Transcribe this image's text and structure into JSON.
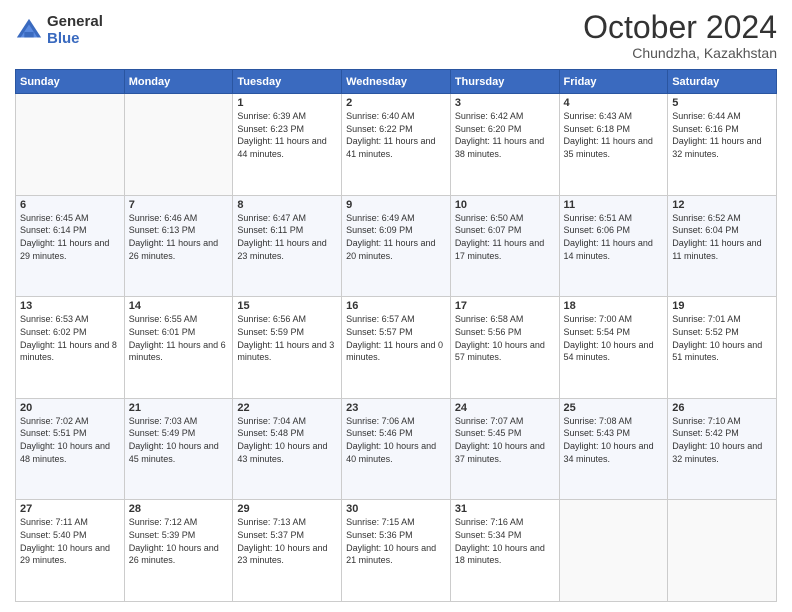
{
  "logo": {
    "general": "General",
    "blue": "Blue"
  },
  "header": {
    "month": "October 2024",
    "location": "Chundzha, Kazakhstan"
  },
  "days_of_week": [
    "Sunday",
    "Monday",
    "Tuesday",
    "Wednesday",
    "Thursday",
    "Friday",
    "Saturday"
  ],
  "weeks": [
    [
      {
        "day": "",
        "sunrise": "",
        "sunset": "",
        "daylight": ""
      },
      {
        "day": "",
        "sunrise": "",
        "sunset": "",
        "daylight": ""
      },
      {
        "day": "1",
        "sunrise": "Sunrise: 6:39 AM",
        "sunset": "Sunset: 6:23 PM",
        "daylight": "Daylight: 11 hours and 44 minutes."
      },
      {
        "day": "2",
        "sunrise": "Sunrise: 6:40 AM",
        "sunset": "Sunset: 6:22 PM",
        "daylight": "Daylight: 11 hours and 41 minutes."
      },
      {
        "day": "3",
        "sunrise": "Sunrise: 6:42 AM",
        "sunset": "Sunset: 6:20 PM",
        "daylight": "Daylight: 11 hours and 38 minutes."
      },
      {
        "day": "4",
        "sunrise": "Sunrise: 6:43 AM",
        "sunset": "Sunset: 6:18 PM",
        "daylight": "Daylight: 11 hours and 35 minutes."
      },
      {
        "day": "5",
        "sunrise": "Sunrise: 6:44 AM",
        "sunset": "Sunset: 6:16 PM",
        "daylight": "Daylight: 11 hours and 32 minutes."
      }
    ],
    [
      {
        "day": "6",
        "sunrise": "Sunrise: 6:45 AM",
        "sunset": "Sunset: 6:14 PM",
        "daylight": "Daylight: 11 hours and 29 minutes."
      },
      {
        "day": "7",
        "sunrise": "Sunrise: 6:46 AM",
        "sunset": "Sunset: 6:13 PM",
        "daylight": "Daylight: 11 hours and 26 minutes."
      },
      {
        "day": "8",
        "sunrise": "Sunrise: 6:47 AM",
        "sunset": "Sunset: 6:11 PM",
        "daylight": "Daylight: 11 hours and 23 minutes."
      },
      {
        "day": "9",
        "sunrise": "Sunrise: 6:49 AM",
        "sunset": "Sunset: 6:09 PM",
        "daylight": "Daylight: 11 hours and 20 minutes."
      },
      {
        "day": "10",
        "sunrise": "Sunrise: 6:50 AM",
        "sunset": "Sunset: 6:07 PM",
        "daylight": "Daylight: 11 hours and 17 minutes."
      },
      {
        "day": "11",
        "sunrise": "Sunrise: 6:51 AM",
        "sunset": "Sunset: 6:06 PM",
        "daylight": "Daylight: 11 hours and 14 minutes."
      },
      {
        "day": "12",
        "sunrise": "Sunrise: 6:52 AM",
        "sunset": "Sunset: 6:04 PM",
        "daylight": "Daylight: 11 hours and 11 minutes."
      }
    ],
    [
      {
        "day": "13",
        "sunrise": "Sunrise: 6:53 AM",
        "sunset": "Sunset: 6:02 PM",
        "daylight": "Daylight: 11 hours and 8 minutes."
      },
      {
        "day": "14",
        "sunrise": "Sunrise: 6:55 AM",
        "sunset": "Sunset: 6:01 PM",
        "daylight": "Daylight: 11 hours and 6 minutes."
      },
      {
        "day": "15",
        "sunrise": "Sunrise: 6:56 AM",
        "sunset": "Sunset: 5:59 PM",
        "daylight": "Daylight: 11 hours and 3 minutes."
      },
      {
        "day": "16",
        "sunrise": "Sunrise: 6:57 AM",
        "sunset": "Sunset: 5:57 PM",
        "daylight": "Daylight: 11 hours and 0 minutes."
      },
      {
        "day": "17",
        "sunrise": "Sunrise: 6:58 AM",
        "sunset": "Sunset: 5:56 PM",
        "daylight": "Daylight: 10 hours and 57 minutes."
      },
      {
        "day": "18",
        "sunrise": "Sunrise: 7:00 AM",
        "sunset": "Sunset: 5:54 PM",
        "daylight": "Daylight: 10 hours and 54 minutes."
      },
      {
        "day": "19",
        "sunrise": "Sunrise: 7:01 AM",
        "sunset": "Sunset: 5:52 PM",
        "daylight": "Daylight: 10 hours and 51 minutes."
      }
    ],
    [
      {
        "day": "20",
        "sunrise": "Sunrise: 7:02 AM",
        "sunset": "Sunset: 5:51 PM",
        "daylight": "Daylight: 10 hours and 48 minutes."
      },
      {
        "day": "21",
        "sunrise": "Sunrise: 7:03 AM",
        "sunset": "Sunset: 5:49 PM",
        "daylight": "Daylight: 10 hours and 45 minutes."
      },
      {
        "day": "22",
        "sunrise": "Sunrise: 7:04 AM",
        "sunset": "Sunset: 5:48 PM",
        "daylight": "Daylight: 10 hours and 43 minutes."
      },
      {
        "day": "23",
        "sunrise": "Sunrise: 7:06 AM",
        "sunset": "Sunset: 5:46 PM",
        "daylight": "Daylight: 10 hours and 40 minutes."
      },
      {
        "day": "24",
        "sunrise": "Sunrise: 7:07 AM",
        "sunset": "Sunset: 5:45 PM",
        "daylight": "Daylight: 10 hours and 37 minutes."
      },
      {
        "day": "25",
        "sunrise": "Sunrise: 7:08 AM",
        "sunset": "Sunset: 5:43 PM",
        "daylight": "Daylight: 10 hours and 34 minutes."
      },
      {
        "day": "26",
        "sunrise": "Sunrise: 7:10 AM",
        "sunset": "Sunset: 5:42 PM",
        "daylight": "Daylight: 10 hours and 32 minutes."
      }
    ],
    [
      {
        "day": "27",
        "sunrise": "Sunrise: 7:11 AM",
        "sunset": "Sunset: 5:40 PM",
        "daylight": "Daylight: 10 hours and 29 minutes."
      },
      {
        "day": "28",
        "sunrise": "Sunrise: 7:12 AM",
        "sunset": "Sunset: 5:39 PM",
        "daylight": "Daylight: 10 hours and 26 minutes."
      },
      {
        "day": "29",
        "sunrise": "Sunrise: 7:13 AM",
        "sunset": "Sunset: 5:37 PM",
        "daylight": "Daylight: 10 hours and 23 minutes."
      },
      {
        "day": "30",
        "sunrise": "Sunrise: 7:15 AM",
        "sunset": "Sunset: 5:36 PM",
        "daylight": "Daylight: 10 hours and 21 minutes."
      },
      {
        "day": "31",
        "sunrise": "Sunrise: 7:16 AM",
        "sunset": "Sunset: 5:34 PM",
        "daylight": "Daylight: 10 hours and 18 minutes."
      },
      {
        "day": "",
        "sunrise": "",
        "sunset": "",
        "daylight": ""
      },
      {
        "day": "",
        "sunrise": "",
        "sunset": "",
        "daylight": ""
      }
    ]
  ]
}
